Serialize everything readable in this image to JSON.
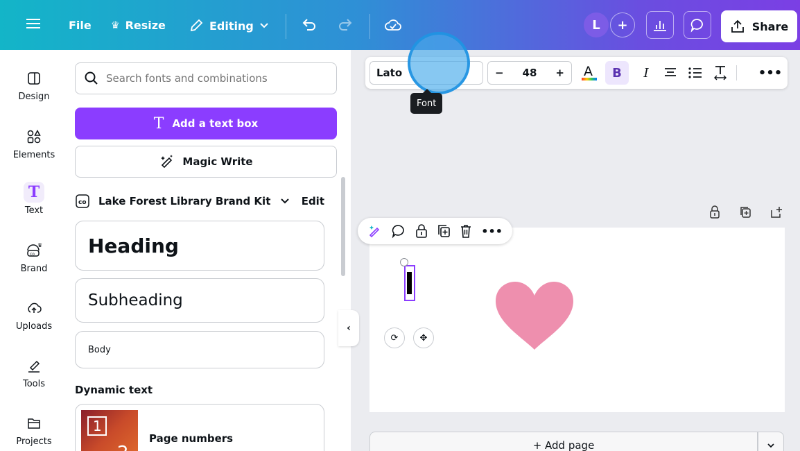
{
  "topbar": {
    "file_label": "File",
    "resize_label": "Resize",
    "editing_label": "Editing",
    "avatar_letter": "L",
    "share_label": "Share"
  },
  "rail": {
    "items": [
      {
        "label": "Design",
        "icon": "design-icon"
      },
      {
        "label": "Elements",
        "icon": "elements-icon"
      },
      {
        "label": "Text",
        "icon": "text-icon",
        "active": true
      },
      {
        "label": "Brand",
        "icon": "brand-icon"
      },
      {
        "label": "Uploads",
        "icon": "uploads-icon"
      },
      {
        "label": "Tools",
        "icon": "tools-icon"
      },
      {
        "label": "Projects",
        "icon": "projects-icon"
      }
    ]
  },
  "panel": {
    "search_placeholder": "Search fonts and combinations",
    "add_text_label": "Add a text box",
    "magic_write_label": "Magic Write",
    "brand_kit_label": "Lake Forest Library Brand Kit",
    "edit_label": "Edit",
    "heading_label": "Heading",
    "subheading_label": "Subheading",
    "body_label": "Body",
    "dynamic_text_label": "Dynamic text",
    "page_numbers_label": "Page numbers"
  },
  "text_toolbar": {
    "font_name": "Lato",
    "font_size": "48",
    "tooltip": "Font",
    "minus": "−",
    "plus": "+",
    "bold": "B",
    "italic": "I"
  },
  "canvas": {
    "add_page_label": "+ Add page",
    "heart_color": "#ee8fae"
  },
  "colors": {
    "accent": "#8b3dff",
    "gradient_start": "#13b5c8",
    "gradient_end": "#7b3fe4"
  }
}
